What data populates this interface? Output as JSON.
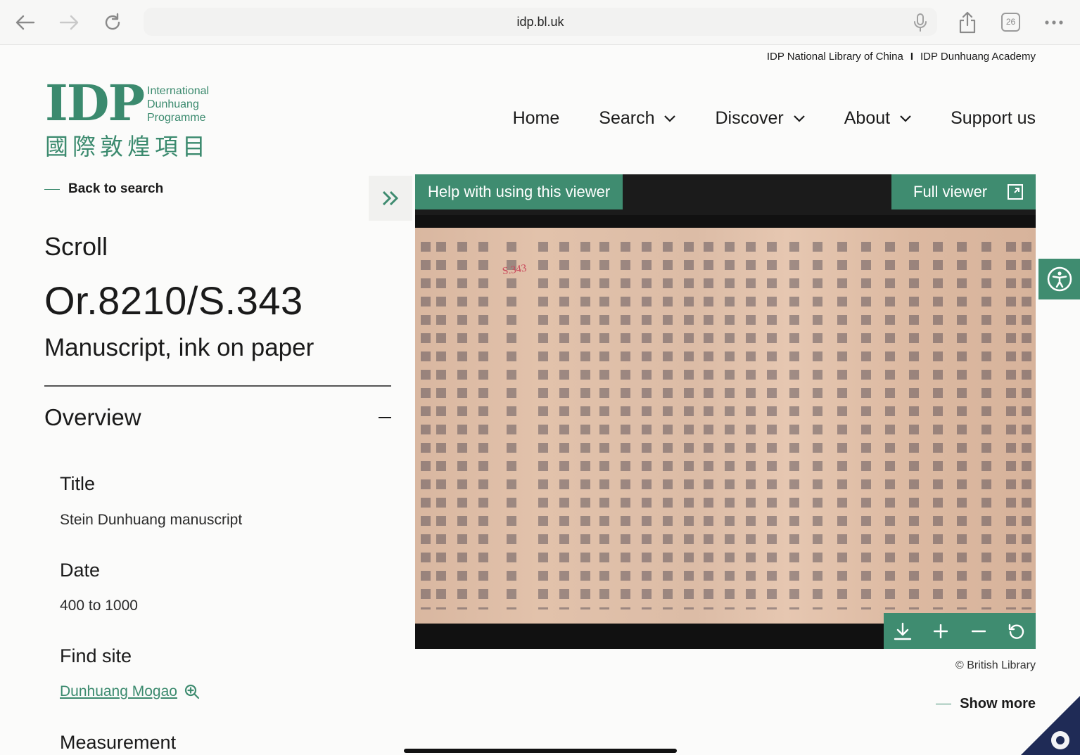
{
  "browser": {
    "url": "idp.bl.uk",
    "tab_count": "26"
  },
  "header": {
    "top_links": [
      "IDP National Library of China",
      "IDP Dunhuang Academy"
    ],
    "top_links_separator": "I",
    "logo": {
      "letters": "IDP",
      "line1": "International",
      "line2": "Dunhuang",
      "line3": "Programme",
      "chinese": "國際敦煌項目"
    },
    "nav": {
      "home": "Home",
      "search": "Search",
      "discover": "Discover",
      "about": "About",
      "support": "Support us"
    }
  },
  "record": {
    "back_label": "Back to search",
    "kind": "Scroll",
    "shelfmark": "Or.8210/S.343",
    "material": "Manuscript, ink on paper",
    "section_title": "Overview",
    "fields": {
      "title_label": "Title",
      "title_value": "Stein Dunhuang manuscript",
      "date_label": "Date",
      "date_value": "400 to 1000",
      "find_site_label": "Find site",
      "find_site_value": "Dunhuang Mogao",
      "measurement_label": "Measurement"
    }
  },
  "viewer": {
    "help_label": "Help with using this viewer",
    "full_label": "Full viewer",
    "seal_text": "S.343",
    "controls": [
      "download-icon",
      "zoom-in-icon",
      "zoom-out-icon",
      "reset-icon"
    ],
    "credit": "© British Library",
    "show_more": "Show more"
  },
  "colors": {
    "brand_green": "#3f8c70",
    "viewer_bg": "#111111",
    "paper": "#dcbca6"
  }
}
